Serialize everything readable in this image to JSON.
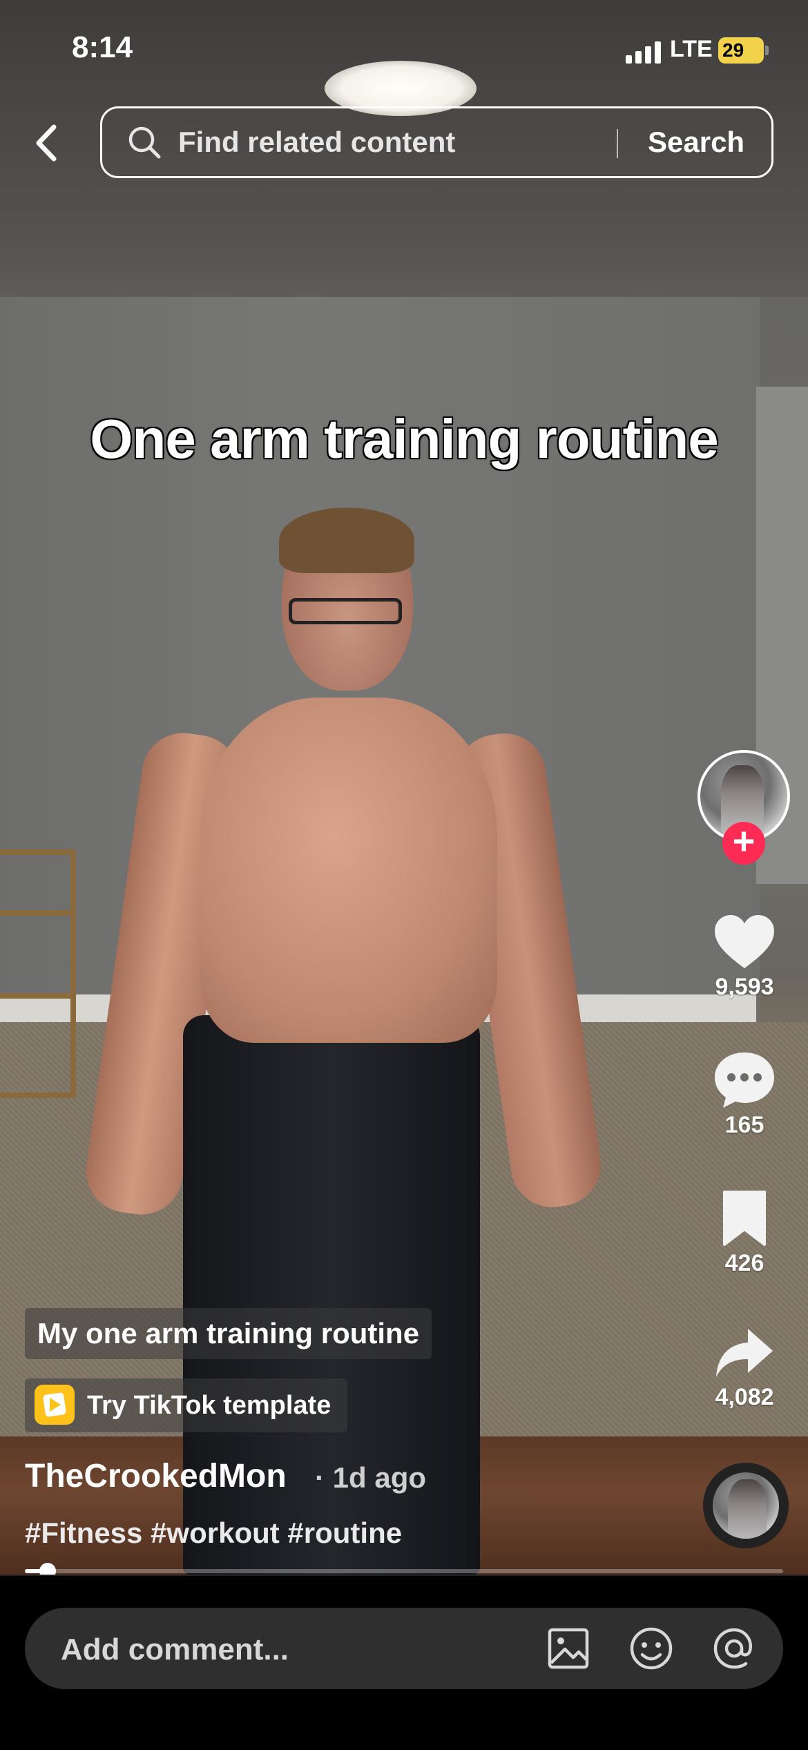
{
  "status_bar": {
    "time": "8:14",
    "network": "LTE",
    "battery": "29"
  },
  "search": {
    "placeholder": "Find related content",
    "button": "Search"
  },
  "video": {
    "overlay_text": "One arm training routine"
  },
  "actions": {
    "likes": "9,593",
    "comments": "165",
    "bookmarks": "426",
    "shares": "4,082"
  },
  "post": {
    "caption_title": "My one arm training routine",
    "template_label": "Try TikTok template",
    "username": "TheCrookedMon",
    "time_ago": "· 1d ago",
    "hashtags": "#Fitness #workout #routine",
    "progress": 0.03
  },
  "comment_bar": {
    "placeholder": "Add comment..."
  },
  "icons": {
    "back": "chevron-left-icon",
    "search": "search-icon",
    "like": "heart-icon",
    "comment": "comment-bubble-icon",
    "bookmark": "bookmark-icon",
    "share": "share-arrow-icon",
    "image": "image-icon",
    "emoji": "emoji-icon",
    "mention": "at-icon"
  },
  "colors": {
    "follow_accent": "#fe2c55",
    "battery": "#f2d24a",
    "template_accent": "#ffc21a"
  }
}
